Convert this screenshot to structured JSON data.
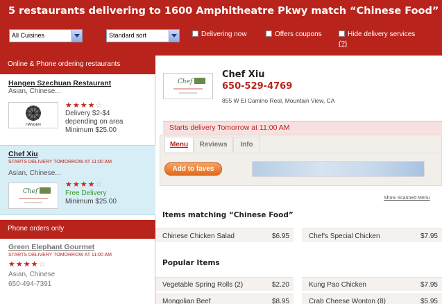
{
  "header": {
    "title": "5 restaurants delivering to 1600 Amphitheatre Pkwy match “Chinese Food”",
    "cuisine_select": "All Cuisines",
    "sort_select": "Standard sort",
    "filter_delivering": "Delivering now",
    "filter_coupons": "Offers coupons",
    "filter_hide_delivery": "Hide delivery services",
    "hide_help": "(?)"
  },
  "sidebar": {
    "section_online": "Online & Phone ordering restaurants",
    "section_phone": "Phone orders only",
    "restaurants": [
      {
        "name": "Hangen Szechuan Restaurant",
        "cuisine": "Asian, Chinese...",
        "logo_text": "HANGEN",
        "rating": 3.5,
        "info1": "Delivery $2-$4",
        "info2": "depending on area",
        "info3": "Minimum $25.00"
      },
      {
        "name": "Chef Xiu",
        "status": "STARTS DELIVERY TOMORROW AT 11:00 AM",
        "cuisine": "Asian, Chinese...",
        "logo_text": "Chef Xiu",
        "rating": 4,
        "info1": "Free Delivery",
        "info2": "Minimum $25.00"
      },
      {
        "name": "Green Elephant Gourmet",
        "status": "STARTS DELIVERY TOMORROW AT 11:00 AM",
        "cuisine": "Asian, Chinese",
        "phone": "650-494-7391",
        "rating": 4
      }
    ]
  },
  "detail": {
    "logo_text": "Chef Xiu",
    "name": "Chef Xiu",
    "phone": "650-529-4769",
    "address": "855 W El Camino Real, Mountain View, CA",
    "start_notice": "Starts delivery Tomorrow at 11:00 AM",
    "tabs": [
      "Menu",
      "Reviews",
      "Info"
    ],
    "faves_button": "Add to faves",
    "scanned_link": "Show Scanned Menu",
    "matching_title": "Items matching “Chinese Food”",
    "matching_items": [
      {
        "name": "Chinese Chicken Salad",
        "price": "$6.95"
      },
      {
        "name": "Chef's Special Chicken",
        "price": "$7.95"
      }
    ],
    "popular_title": "Popular Items",
    "popular_items": [
      {
        "name": "Vegetable Spring Rolls (2)",
        "price": "$2.20"
      },
      {
        "name": "Kung Pao Chicken",
        "price": "$7.95"
      },
      {
        "name": "Mongolian Beef",
        "price": "$8.95"
      },
      {
        "name": "Crab Cheese Wonton (8)",
        "price": "$5.95"
      }
    ]
  },
  "colors": {
    "brand_red": "#b8241c",
    "selected_bg": "#d8eef6",
    "button_orange": "#e8782a"
  }
}
